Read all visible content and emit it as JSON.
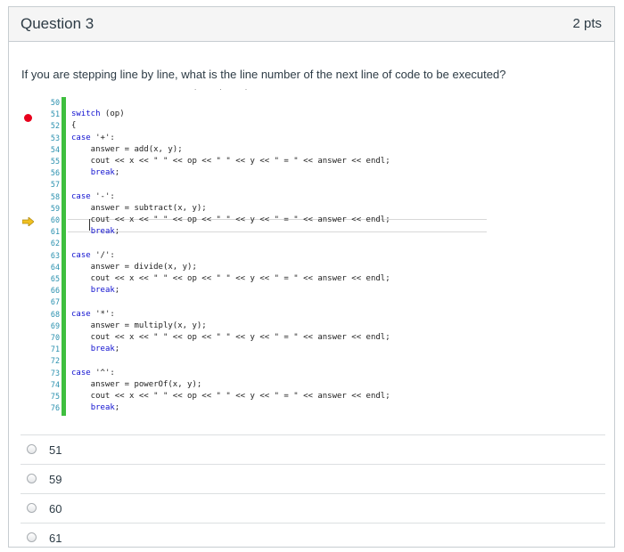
{
  "question": {
    "title": "Question 3",
    "points": "2 pts",
    "text": "If you are stepping line by line, what is the line number of the next line of code to be executed?",
    "dots": ". . ."
  },
  "code": {
    "line_numbers": [
      "50",
      "51",
      "52",
      "53",
      "54",
      "55",
      "56",
      "57",
      "58",
      "59",
      "60",
      "61",
      "62",
      "63",
      "64",
      "65",
      "66",
      "67",
      "68",
      "69",
      "70",
      "71",
      "72",
      "73",
      "74",
      "75",
      "76"
    ],
    "lines": [
      "",
      "switch (op)",
      "{",
      "case '+':",
      "    answer = add(x, y);",
      "    cout << x << \" \" << op << \" \" << y << \" = \" << answer << endl;",
      "    break;",
      "",
      "case '-':",
      "    answer = subtract(x, y);",
      "    cout << x << \" \" << op << \" \" << y << \" = \" << answer << endl;",
      "    break;",
      "",
      "case '/':",
      "    answer = divide(x, y);",
      "    cout << x << \" \" << op << \" \" << y << \" = \" << answer << endl;",
      "    break;",
      "",
      "case '*':",
      "    answer = multiply(x, y);",
      "    cout << x << \" \" << op << \" \" << y << \" = \" << answer << endl;",
      "    break;",
      "",
      "case '^':",
      "    answer = powerOf(x, y);",
      "    cout << x << \" \" << op << \" \" << y << \" = \" << answer << endl;",
      "    break;"
    ],
    "breakpoint_color": "#e8001c",
    "execution_arrow_color": "#f0c020",
    "coverage_bar_color": "#3fbf3f",
    "line_number_color": "#2b91af"
  },
  "answers": [
    {
      "label": "51"
    },
    {
      "label": "59"
    },
    {
      "label": "60"
    },
    {
      "label": "61"
    }
  ]
}
